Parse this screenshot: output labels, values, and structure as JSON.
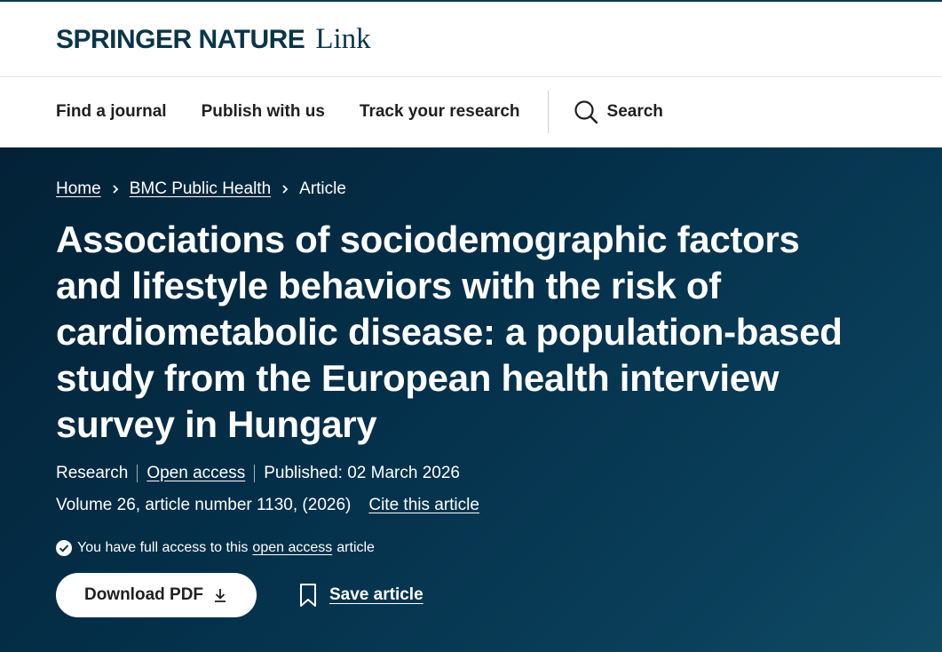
{
  "header": {
    "brand": "Springer Nature",
    "brand_suffix": "Link"
  },
  "nav": {
    "items": [
      {
        "label": "Find a journal"
      },
      {
        "label": "Publish with us"
      },
      {
        "label": "Track your research"
      }
    ],
    "search_label": "Search"
  },
  "breadcrumb": {
    "home": "Home",
    "journal": "BMC Public Health",
    "current": "Article"
  },
  "article": {
    "title": "Associations of sociodemographic factors and lifestyle behaviors with the risk of cardiometabolic disease: a population-based study from the European health interview survey in Hungary",
    "type": "Research",
    "access": "Open access",
    "published": "Published: 02 March 2026",
    "volume": "Volume 26, article number 1130, (2026)",
    "cite_label": "Cite this article",
    "access_note_prefix": "You have full access to this",
    "access_note_link": "open access",
    "access_note_suffix": "article"
  },
  "actions": {
    "download_label": "Download PDF",
    "save_label": "Save article"
  },
  "colors": {
    "brand": "#0b3547",
    "hero_bg": "#04304a"
  }
}
